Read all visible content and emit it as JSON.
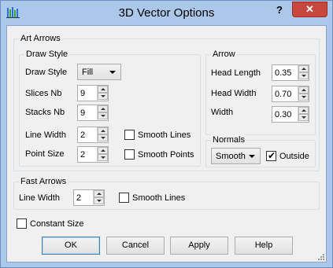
{
  "window": {
    "title": "3D Vector Options",
    "help": "?",
    "close": "✕"
  },
  "art_arrows": {
    "title": "Art Arrows",
    "draw_style_group": {
      "title": "Draw Style",
      "draw_style_label": "Draw Style",
      "draw_style_value": "Fill",
      "slices_label": "Slices Nb",
      "slices_value": "9",
      "stacks_label": "Stacks Nb",
      "stacks_value": "9",
      "line_width_label": "Line Width",
      "line_width_value": "2",
      "smooth_lines_label": "Smooth Lines",
      "smooth_lines_checked": false,
      "point_size_label": "Point Size",
      "point_size_value": "2",
      "smooth_points_label": "Smooth Points",
      "smooth_points_checked": false
    },
    "arrow_group": {
      "title": "Arrow",
      "head_length_label": "Head Length",
      "head_length_value": "0.35",
      "head_width_label": "Head Width",
      "head_width_value": "0.70",
      "width_label": "Width",
      "width_value": "0.30"
    },
    "normals_group": {
      "title": "Normals",
      "mode_value": "Smooth",
      "outside_label": "Outside",
      "outside_checked": true
    }
  },
  "fast_arrows": {
    "title": "Fast Arrows",
    "line_width_label": "Line Width",
    "line_width_value": "2",
    "smooth_lines_label": "Smooth Lines",
    "smooth_lines_checked": false
  },
  "constant_size": {
    "label": "Constant Size",
    "checked": false
  },
  "buttons": {
    "ok": "OK",
    "cancel": "Cancel",
    "apply": "Apply",
    "help": "Help"
  },
  "colors": {
    "frame": "#abc8ea",
    "client": "#f0f0f0",
    "close": "#c7463e",
    "default_border": "#3c7fb1"
  }
}
